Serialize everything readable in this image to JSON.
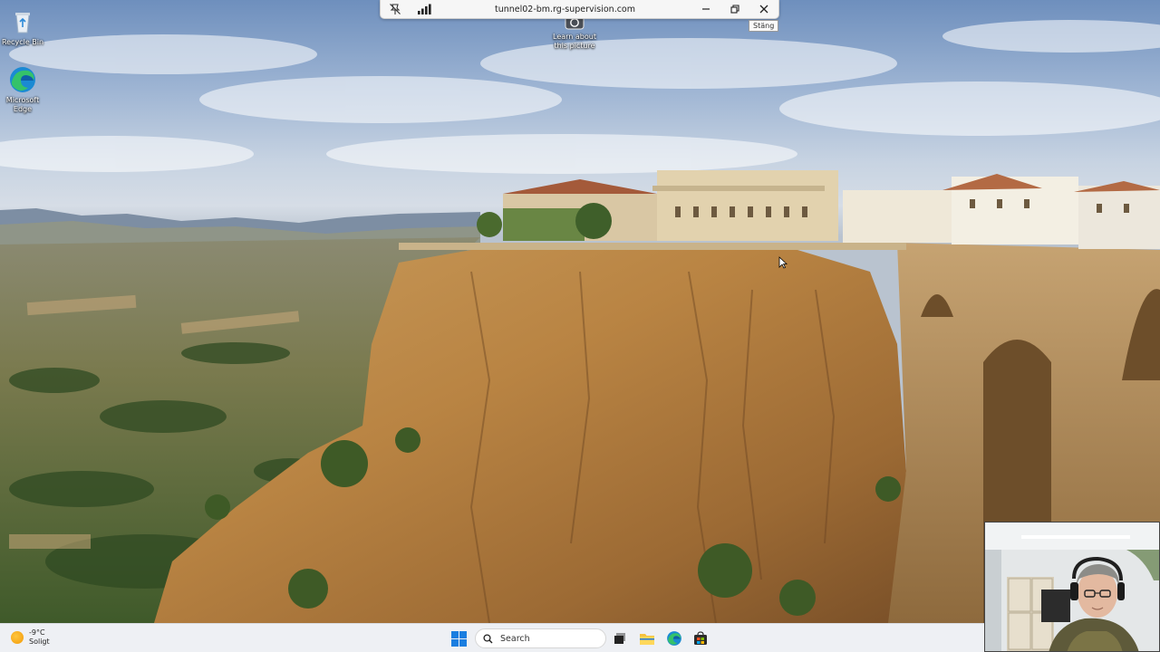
{
  "desktop": {
    "icons": [
      {
        "id": "recycle-bin",
        "label": "Recycle Bin"
      },
      {
        "id": "microsoft-edge",
        "label": "Microsoft Edge"
      },
      {
        "id": "learn-about-picture",
        "label": "Learn about this picture"
      }
    ]
  },
  "remote_toolbar": {
    "title": "tunnel02-bm.rg-supervision.com",
    "tooltip": "Stäng",
    "icons": [
      "no-pin-icon",
      "signal-bars-icon",
      "minimize-icon",
      "restore-icon",
      "close-icon"
    ]
  },
  "taskbar": {
    "weather": {
      "temperature": "-9°C",
      "condition": "Soligt"
    },
    "search": {
      "placeholder": "Search"
    },
    "apps": [
      "windows-start-icon",
      "task-view-icon",
      "file-explorer-icon",
      "edge-icon",
      "store-icon"
    ]
  },
  "colors": {
    "taskbar_bg": "#eef0f4",
    "windows_blue": "#1a7ee0",
    "toolbar_bg": "#f6f6f6"
  }
}
